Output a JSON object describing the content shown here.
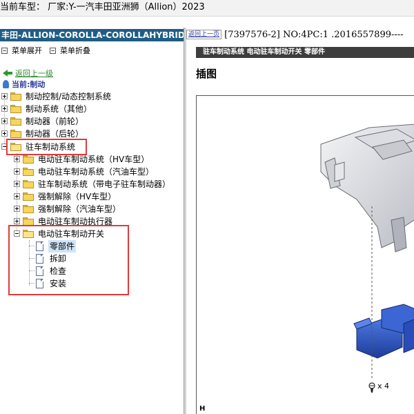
{
  "window": {
    "title": "当前车型：  厂家:Y-一汽丰田亚洲狮（Allion）2023"
  },
  "left": {
    "header": "丰田-ALLION-COROLLA-COROLLAHYBRID-LEVI",
    "expand_all": "菜单展开",
    "collapse_all": "菜单折叠",
    "back_link": "返回上一级",
    "current": "当前:制动",
    "tree": [
      "制动控制/动态控制系统",
      "制动系统（其他）",
      "制动器（前轮）",
      "制动器（后轮）",
      "驻车制动系统"
    ],
    "sub_tree": [
      "电动驻车制动系统（HV车型）",
      "电动驻车制动系统（汽油车型）",
      "驻车制动系统（带电子驻车制动器）",
      "强制解除（HV车型）",
      "强制解除（汽油车型）",
      "电动驻车制动执行器",
      "电动驻车制动开关"
    ],
    "leaves": [
      "零部件",
      "拆卸",
      "检查",
      "安装"
    ]
  },
  "right": {
    "back_link": "返回上一页",
    "doc_ref": "[7397576-2] NO:4PC:1 .2016557899----",
    "subheader": "驻车制动系统  电动驻车制动开关  零部件",
    "section_title": "插图",
    "screw_label": "x 4",
    "figure_code": "H"
  },
  "colors": {
    "header_bg": "#1f5d86",
    "highlight": "#e03a3a",
    "subhead_bg": "#3d3d3d"
  }
}
